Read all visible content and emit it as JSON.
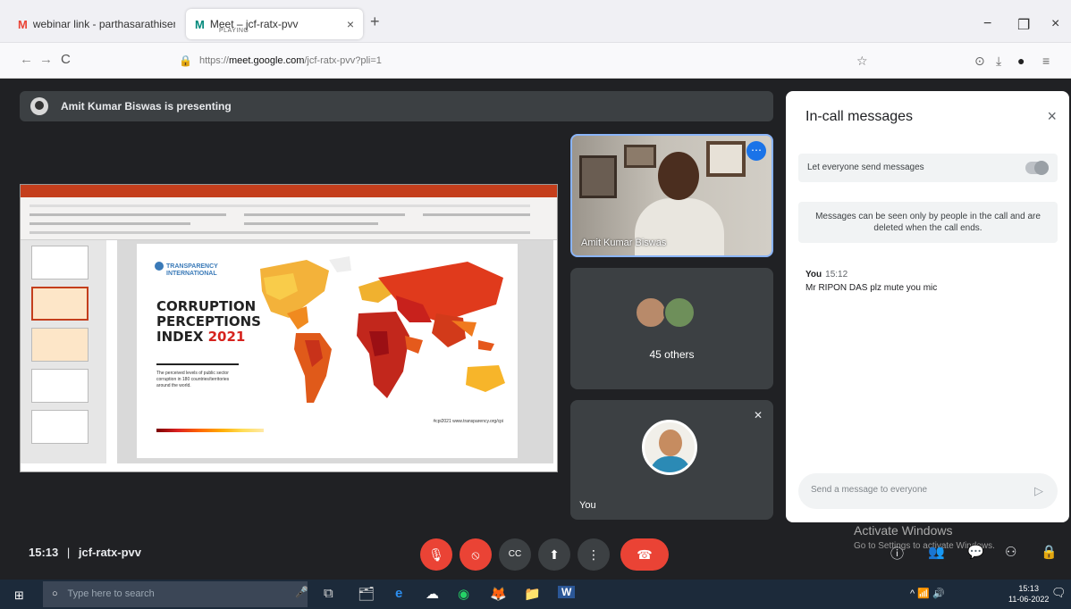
{
  "browser": {
    "tabs": [
      {
        "favicon": "M",
        "favicon_color": "#ea4335",
        "title": "webinar link - parthasarathisen ✕",
        "close": "×"
      },
      {
        "favicon": "M",
        "favicon_color": "#00897b",
        "title": "Meet – jcf-ratx-pvv",
        "subtitle": "PLAYING",
        "close": "×"
      }
    ],
    "new_tab": "+",
    "window_controls": {
      "minimize": "−",
      "maximize": "❐",
      "close": "×"
    },
    "nav": {
      "back": "←",
      "forward": "→",
      "reload": "C"
    },
    "url_prefix": "https://",
    "url_domain": "meet.google.com",
    "url_path": "/jcf-ratx-pvv?pli=1",
    "toolbar_icons": {
      "bookmark": "☆",
      "pocket": "⊙",
      "download": "⤓",
      "profile": "●",
      "menu": "≡"
    }
  },
  "meet": {
    "presenting_banner": "Amit Kumar Biswas is presenting",
    "slide": {
      "org_line1": "TRANSPARENCY",
      "org_line2": "INTERNATIONAL",
      "title_line1": "CORRUPTION",
      "title_line2": "PERCEPTIONS",
      "title_line3": "INDEX ",
      "title_year": "2021",
      "blurb": "The perceived levels of public sector corruption in 180 countries/territories around the world.",
      "note": "#cpi2021 www.transparency.org/cpi"
    },
    "tiles": {
      "presenter_name": "Amit Kumar Biswas",
      "more_icon": "⋯",
      "others_count": "45 others",
      "you_label": "You",
      "mic_off_icon": "✕"
    },
    "chat": {
      "title": "In-call messages",
      "close": "×",
      "toggle_label": "Let everyone send messages",
      "info": "Messages can be seen only by people in the call and are deleted when the call ends.",
      "messages": [
        {
          "sender": "You",
          "time": "15:12",
          "text": "Mr RIPON DAS plz mute you mic"
        }
      ],
      "input_placeholder": "Send a message to everyone",
      "send_icon": "▷"
    },
    "bottom": {
      "time": "15:13",
      "separator": "|",
      "meeting_code": "jcf-ratx-pvv",
      "controls": {
        "mic": "🎙",
        "camera": "⦸",
        "captions": "CC",
        "present": "⬆",
        "more": "⋮",
        "leave": "☎"
      },
      "activate_title": "Activate Windows",
      "activate_sub": "Go to Settings to activate Windows.",
      "right_controls": {
        "info": "ⓘ",
        "people": "👥",
        "chat": "💬",
        "activities": "⚇",
        "lock": "🔒"
      }
    }
  },
  "taskbar": {
    "start": "⊞",
    "search_placeholder": "Type here to search",
    "search_icon": "○",
    "icons": [
      "🎤",
      "⧉",
      "🗂",
      "e",
      "☁",
      "◉",
      "🦊",
      "📁",
      "W"
    ],
    "tray": "^ 📶 🔊",
    "clock_time": "15:13",
    "clock_date": "11-06-2022",
    "notify": "🗨"
  }
}
